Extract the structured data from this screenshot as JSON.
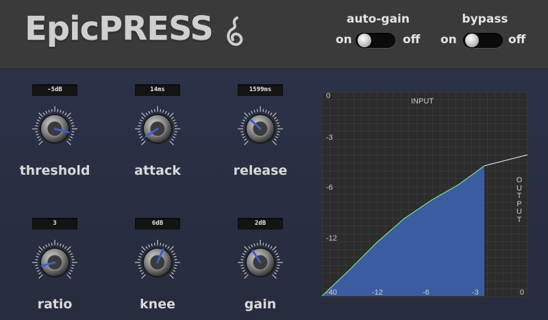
{
  "header": {
    "brand": "EpicPRESS",
    "auto_gain": {
      "title": "auto-gain",
      "on_label": "on",
      "off_label": "off"
    },
    "bypass": {
      "title": "bypass",
      "on_label": "on",
      "off_label": "off"
    }
  },
  "controls": [
    {
      "label": "threshold",
      "value": "-5dB"
    },
    {
      "label": "attack",
      "value": "14ms"
    },
    {
      "label": "release",
      "value": "1599ms"
    },
    {
      "label": "ratio",
      "value": "3"
    },
    {
      "label": "knee",
      "value": "6dB"
    },
    {
      "label": "gain",
      "value": "2dB"
    }
  ],
  "graph": {
    "input_label": "INPUT",
    "output_label": "OUTPUT",
    "y_ticks": [
      "0",
      "-3",
      "-6",
      "-12"
    ],
    "x_ticks": [
      "-40",
      "-12",
      "-6",
      "-3",
      "0"
    ]
  },
  "colors": {
    "accent_blue": "#3d5fa8",
    "curve_green": "#7ee08a",
    "header_bg": "#3a3a3a",
    "panel_bg": "#272c3e"
  }
}
